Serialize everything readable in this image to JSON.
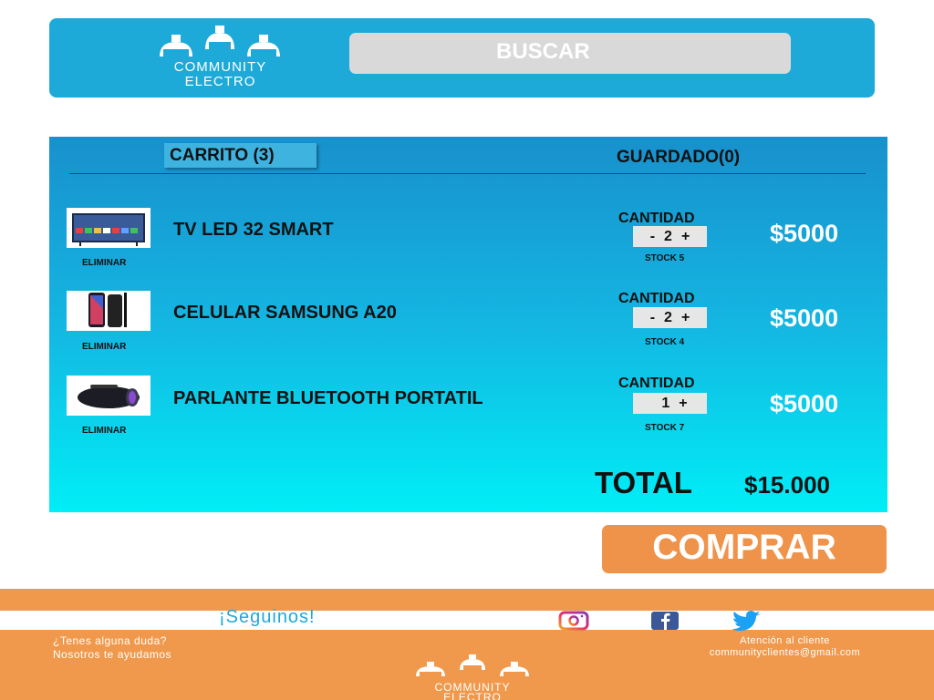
{
  "header": {
    "logo_line1": "COMMUNITY",
    "logo_line2": "ELECTRO",
    "search_label": "BUSCAR"
  },
  "cart": {
    "tab_cart_label": "CARRITO (3)",
    "tab_saved_label": "GUARDADO(0)",
    "items": [
      {
        "name": "TV LED 32 SMART",
        "remove_label": "ELIMINAR",
        "quantity_label": "CANTIDAD",
        "qty_minus": "-",
        "quantity": "2",
        "qty_plus": "+",
        "stock": "STOCK 5",
        "price": "$5000",
        "thumb_icon": "tv-icon"
      },
      {
        "name": "CELULAR SAMSUNG A20",
        "remove_label": "ELIMINAR",
        "quantity_label": "CANTIDAD",
        "qty_minus": "-",
        "quantity": "2",
        "qty_plus": "+",
        "stock": "STOCK 4",
        "price": "$5000",
        "thumb_icon": "phone-icon"
      },
      {
        "name": "PARLANTE BLUETOOTH PORTATIL",
        "remove_label": "ELIMINAR",
        "quantity_label": "CANTIDAD",
        "qty_minus": "",
        "quantity": "1",
        "qty_plus": "+",
        "stock": "STOCK 7",
        "price": "$5000",
        "thumb_icon": "speaker-icon"
      }
    ],
    "total_label": "TOTAL",
    "total_value": "$15.000"
  },
  "buy_label": "COMPRAR",
  "footer": {
    "follow_label": "¡Seguinos!",
    "social_icons": [
      "instagram-icon",
      "facebook-icon",
      "twitter-icon"
    ],
    "doubt_line1": "¿Tenes alguna duda?",
    "doubt_line2": "Nosotros te ayudamos",
    "support_line1": "Atención al cliente",
    "support_line2": "communityclientes@gmail.com",
    "logo_line1": "COMMUNITY",
    "logo_line2": "ELECTRO"
  },
  "colors": {
    "header_blue": "#1eaad8",
    "cart_gradient_top": "#1890cc",
    "cart_gradient_bottom": "#00eef6",
    "orange": "#f0934a",
    "footer_orange": "#f0994c"
  }
}
